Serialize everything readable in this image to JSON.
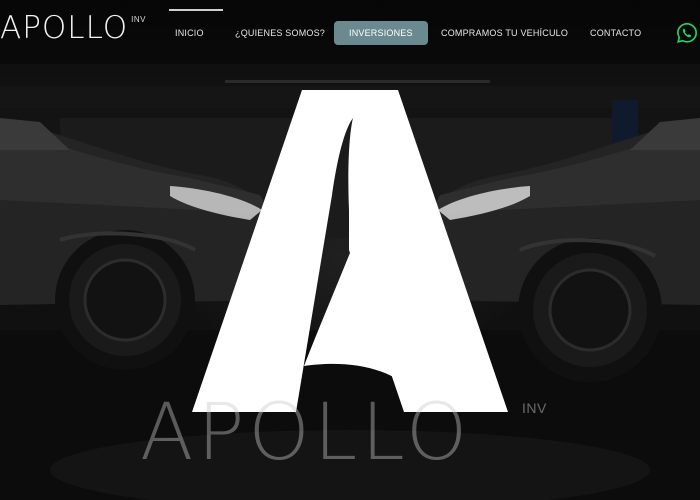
{
  "brand": {
    "name": "APOLLO",
    "suffix": "INV"
  },
  "nav": {
    "items": [
      {
        "label": "INICIO"
      },
      {
        "label": "¿QUIENES SOMOS?"
      },
      {
        "label": "INVERSIONES"
      },
      {
        "label": "COMPRAMOS TU VEHÍCULO"
      },
      {
        "label": "CONTACTO"
      }
    ],
    "whatsapp_icon": "whatsapp-icon"
  },
  "hero": {
    "logo_icon": "apollo-a-logo",
    "wordmark": "APOLLO",
    "suffix": "INV"
  },
  "colors": {
    "accent_pill": "#6b8a8f",
    "whatsapp": "#25d366",
    "logo": "#ffffff"
  }
}
